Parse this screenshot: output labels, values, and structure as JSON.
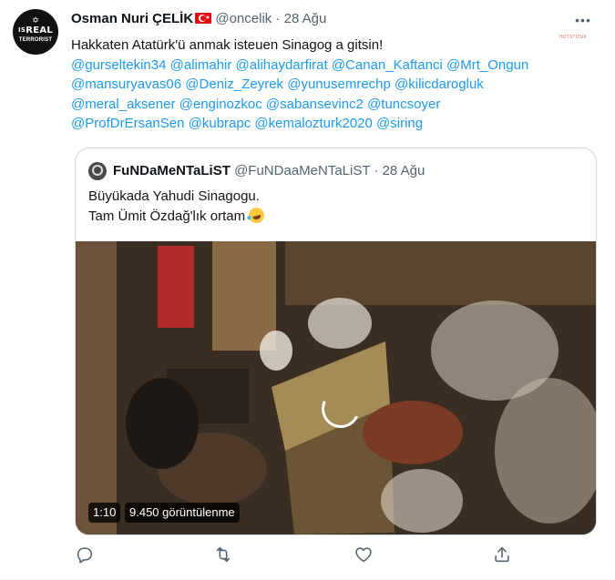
{
  "tweet": {
    "author_name": "Osman Nuri ÇELİK",
    "author_handle": "@oncelik",
    "separator": "·",
    "date": "28 Ağu",
    "avatar_text_top": "IS",
    "avatar_text_main": "REAL",
    "avatar_text_bottom": "TERRORIST",
    "avatar_star": "✡",
    "flag": "turkey-flag",
    "more_icon": "•••",
    "watermark": "HUTSTUSIK",
    "text_line": "Hakkaten Atatürk'ü anmak isteuen Sinagog a gitsin!",
    "mention_lines": [
      [
        "@gurseltekin34",
        "@alimahir",
        "@alihaydarfirat",
        "@Canan_Kaftanci",
        "@Mrt_Ongun"
      ],
      [
        "@mansuryavas06",
        "@Deniz_Zeyrek",
        "@yunusemrechp",
        "@kilicdarogluk"
      ],
      [
        "@meral_aksener",
        "@enginozkoc",
        "@sabansevinc2",
        "@tuncsoyer"
      ],
      [
        "@ProfDrErsanSen",
        "@kubrapc",
        "@kemalozturk2020",
        "@siring"
      ]
    ]
  },
  "quoted": {
    "author_name": "FuNDaMeNTaLiST",
    "author_handle": "@FuNDaaMeNTaLiST",
    "separator": "·",
    "date": "28 Ağu",
    "text_lines": [
      "Büyükada Yahudi Sinagogu.",
      "Tam Ümit Özdağ'lık ortam"
    ],
    "emoji": "rolling-on-floor-laughing-emoji",
    "video": {
      "duration": "1:10",
      "views": "9.450 görüntülenme",
      "loading": true
    }
  },
  "actions": [
    {
      "name": "reply",
      "icon": "reply-icon"
    },
    {
      "name": "retweet",
      "icon": "retweet-icon"
    },
    {
      "name": "like",
      "icon": "heart-icon"
    },
    {
      "name": "share",
      "icon": "share-icon"
    }
  ],
  "colors": {
    "link": "#1d9bf0",
    "muted": "#536471",
    "text": "#0f1419",
    "border": "#cfd9de"
  }
}
